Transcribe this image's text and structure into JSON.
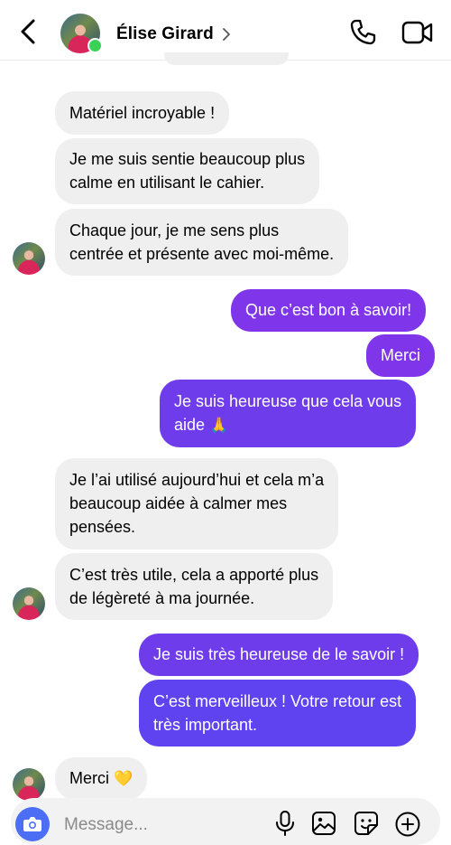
{
  "header": {
    "contact_name": "Élise Girard"
  },
  "messages": [
    {
      "id": 1,
      "direction": "in",
      "text": "Matériel incroyable !"
    },
    {
      "id": 2,
      "direction": "in",
      "lines": [
        "Je me suis sentie beaucoup plus",
        "calme en utilisant le cahier."
      ]
    },
    {
      "id": 3,
      "direction": "in",
      "lines": [
        "Chaque jour, je me sens plus",
        "centrée et présente avec moi-même."
      ]
    },
    {
      "id": 4,
      "direction": "out",
      "text": "Que c’est bon à savoir!"
    },
    {
      "id": 5,
      "direction": "out",
      "text": "Merci"
    },
    {
      "id": 6,
      "direction": "out",
      "lines": [
        "Je suis heureuse que cela vous",
        "aide"
      ],
      "emoji": "🙏"
    },
    {
      "id": 7,
      "direction": "in",
      "lines": [
        "Je l’ai utilisé aujourd’hui et cela m’a",
        "beaucoup aidée à calmer mes",
        "pensées."
      ]
    },
    {
      "id": 8,
      "direction": "in",
      "lines": [
        "C’est très utile, cela a apporté plus",
        "de légèreté à ma journée."
      ]
    },
    {
      "id": 9,
      "direction": "out",
      "text": "Je suis très heureuse de le savoir !"
    },
    {
      "id": 10,
      "direction": "out",
      "lines": [
        "C’est merveilleux ! Votre retour est",
        "très important."
      ]
    },
    {
      "id": 11,
      "direction": "in",
      "text": "Merci",
      "emoji": "💛"
    }
  ],
  "composer": {
    "placeholder": "Message..."
  },
  "colors": {
    "outgoing_top": "#7f36ea",
    "outgoing_bottom": "#5f42f0",
    "incoming": "#efefef",
    "camera_button": "#4c6ef5",
    "online": "#3ad157"
  }
}
